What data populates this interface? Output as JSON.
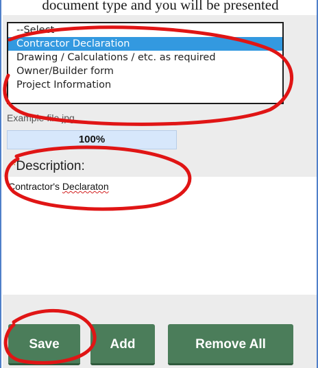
{
  "caption": "document type and you will be presented",
  "document_type": {
    "options": [
      "--Select--",
      "Contractor Declaration",
      "Drawing / Calculations / etc. as required",
      "Owner/Builder form",
      "Project Information"
    ],
    "selected": "Contractor Declaration"
  },
  "file": {
    "name": "Example file.jpg",
    "progress_percent": 100,
    "progress_label": "100%"
  },
  "description": {
    "required_marker": "*",
    "label": "Description:",
    "value_prefix": "Contractor's ",
    "value_misspelled": "Declaraton"
  },
  "buttons": {
    "save": "Save",
    "add": "Add",
    "remove_all": "Remove All"
  },
  "colors": {
    "button_green": "#4b7d5a",
    "selection_blue": "#3399e0",
    "annotation_red": "#e01515",
    "required_orange": "#e47a2f"
  }
}
